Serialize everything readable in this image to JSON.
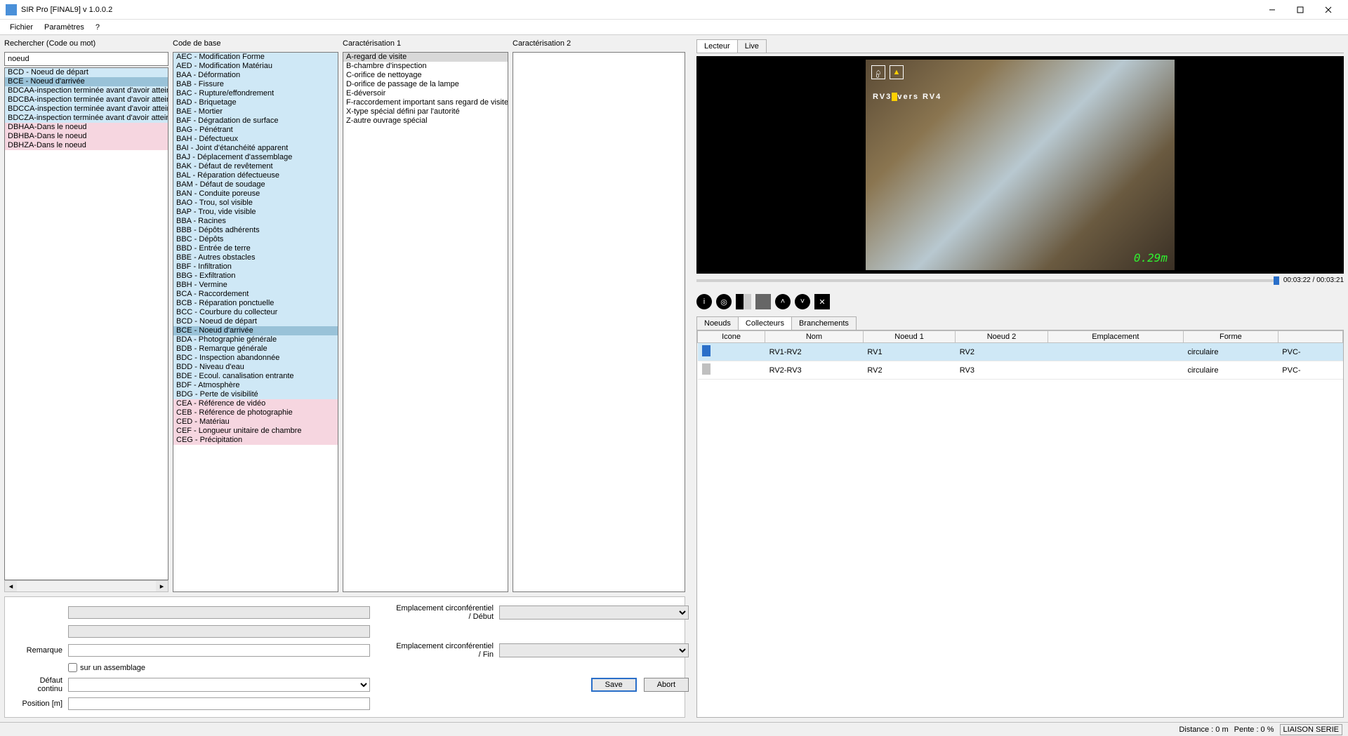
{
  "window": {
    "title": "SIR Pro [FINAL9]   v 1.0.0.2"
  },
  "menu": {
    "items": [
      "Fichier",
      "Paramètres",
      "?"
    ]
  },
  "search": {
    "label": "Rechercher (Code ou mot)",
    "value": "noeud",
    "results": [
      {
        "text": "BCD - Noeud de départ",
        "cls": "bg-blue"
      },
      {
        "text": "BCE - Noeud d'arrivée",
        "cls": "bg-darkblue"
      },
      {
        "text": "BDCAA-inspection terminée avant d'avoir atteint le noeu",
        "cls": "bg-blue"
      },
      {
        "text": "BDCBA-inspection terminée avant d'avoir atteint le noeu",
        "cls": "bg-blue"
      },
      {
        "text": "BDCCA-inspection terminée avant d'avoir atteint le noeu",
        "cls": "bg-blue"
      },
      {
        "text": "BDCZA-inspection terminée avant d'avoir atteint le noeu",
        "cls": "bg-blue"
      },
      {
        "text": "DBHAA-Dans le noeud",
        "cls": "bg-pink"
      },
      {
        "text": "DBHBA-Dans le noeud",
        "cls": "bg-pink"
      },
      {
        "text": "DBHZA-Dans le noeud",
        "cls": "bg-pink"
      }
    ]
  },
  "codes": {
    "label": "Code de base",
    "items": [
      {
        "text": "AEC - Modification Forme",
        "cls": "bg-blue"
      },
      {
        "text": "AED - Modification Matériau",
        "cls": "bg-blue"
      },
      {
        "text": "BAA - Déformation",
        "cls": "bg-blue"
      },
      {
        "text": "BAB - Fissure",
        "cls": "bg-blue"
      },
      {
        "text": "BAC - Rupture/effondrement",
        "cls": "bg-blue"
      },
      {
        "text": "BAD - Briquetage",
        "cls": "bg-blue"
      },
      {
        "text": "BAE - Mortier",
        "cls": "bg-blue"
      },
      {
        "text": "BAF - Dégradation de surface",
        "cls": "bg-blue"
      },
      {
        "text": "BAG - Pénétrant",
        "cls": "bg-blue"
      },
      {
        "text": "BAH - Défectueux",
        "cls": "bg-blue"
      },
      {
        "text": "BAI - Joint d'étanchéité apparent",
        "cls": "bg-blue"
      },
      {
        "text": "BAJ - Déplacement d'assemblage",
        "cls": "bg-blue"
      },
      {
        "text": "BAK - Défaut de revêtement",
        "cls": "bg-blue"
      },
      {
        "text": "BAL - Réparation défectueuse",
        "cls": "bg-blue"
      },
      {
        "text": "BAM - Défaut de soudage",
        "cls": "bg-blue"
      },
      {
        "text": "BAN - Conduite poreuse",
        "cls": "bg-blue"
      },
      {
        "text": "BAO - Trou, sol visible",
        "cls": "bg-blue"
      },
      {
        "text": "BAP - Trou, vide visible",
        "cls": "bg-blue"
      },
      {
        "text": "BBA - Racines",
        "cls": "bg-blue"
      },
      {
        "text": "BBB - Dépôts adhérents",
        "cls": "bg-blue"
      },
      {
        "text": "BBC - Dépôts",
        "cls": "bg-blue"
      },
      {
        "text": "BBD - Entrée de terre",
        "cls": "bg-blue"
      },
      {
        "text": "BBE - Autres obstacles",
        "cls": "bg-blue"
      },
      {
        "text": "BBF - Infiltration",
        "cls": "bg-blue"
      },
      {
        "text": "BBG - Exfiltration",
        "cls": "bg-blue"
      },
      {
        "text": "BBH - Vermine",
        "cls": "bg-blue"
      },
      {
        "text": "BCA - Raccordement",
        "cls": "bg-blue"
      },
      {
        "text": "BCB - Réparation ponctuelle",
        "cls": "bg-blue"
      },
      {
        "text": "BCC - Courbure du collecteur",
        "cls": "bg-blue"
      },
      {
        "text": "BCD - Noeud de départ",
        "cls": "bg-blue"
      },
      {
        "text": "BCE - Noeud d'arrivée",
        "cls": "bg-darkblue"
      },
      {
        "text": "BDA - Photographie générale",
        "cls": "bg-blue"
      },
      {
        "text": "BDB - Remarque générale",
        "cls": "bg-blue"
      },
      {
        "text": "BDC - Inspection abandonnée",
        "cls": "bg-blue"
      },
      {
        "text": "BDD - Niveau d'eau",
        "cls": "bg-blue"
      },
      {
        "text": "BDE - Ecoul. canalisation entrante",
        "cls": "bg-blue"
      },
      {
        "text": "BDF - Atmosphère",
        "cls": "bg-blue"
      },
      {
        "text": "BDG - Perte de visibilité",
        "cls": "bg-blue"
      },
      {
        "text": "CEA - Référence de vidéo",
        "cls": "bg-pink"
      },
      {
        "text": "CEB - Référence de photographie",
        "cls": "bg-pink"
      },
      {
        "text": "CED - Matériau",
        "cls": "bg-pink"
      },
      {
        "text": "CEF - Longueur unitaire de chambre",
        "cls": "bg-pink"
      },
      {
        "text": "CEG - Précipitation",
        "cls": "bg-pink"
      }
    ]
  },
  "carac1": {
    "label": "Caractérisation 1",
    "items": [
      "A-regard de visite",
      "B-chambre d'inspection",
      "C-orifice de nettoyage",
      "D-orifice de passage de la lampe",
      "E-déversoir",
      "F-raccordement important sans regard de visite",
      "X-type spécial défini par l'autorité",
      "Z-autre ouvrage spécial"
    ]
  },
  "carac2": {
    "label": "Caractérisation 2"
  },
  "form": {
    "remarque_label": "Remarque",
    "assemblage_label": "sur un assemblage",
    "defaut_label": "Défaut continu",
    "position_label": "Position [m]",
    "circ_debut_label": "Emplacement circonférentiel / Début",
    "circ_fin_label": "Emplacement circonférentiel / Fin",
    "save": "Save",
    "abort": "Abort"
  },
  "reader_tabs": {
    "lecteur": "Lecteur",
    "live": "Live"
  },
  "video": {
    "overlay_text_a": "RV3",
    "overlay_text_b": "vers RV4",
    "distance_overlay": "0.29m",
    "time": "00:03:22 / 00:03:21",
    "house_badge": "0"
  },
  "lower_tabs": {
    "noeuds": "Noeuds",
    "collecteurs": "Collecteurs",
    "branchements": "Branchements"
  },
  "table": {
    "headers": [
      "Icone",
      "Nom",
      "Noeud 1",
      "Noeud 2",
      "Emplacement",
      "Forme",
      ""
    ],
    "rows": [
      {
        "color": "#2a6fc9",
        "nom": "RV1-RV2",
        "n1": "RV1",
        "n2": "RV2",
        "emp": "",
        "forme": "circulaire",
        "mat": "PVC-"
      },
      {
        "color": "#c0c0c0",
        "nom": "RV2-RV3",
        "n1": "RV2",
        "n2": "RV3",
        "emp": "",
        "forme": "circulaire",
        "mat": "PVC-"
      }
    ]
  },
  "status": {
    "dist": "Distance : 0 m",
    "pente": "Pente : 0 %",
    "liaison": "LIAISON SERIE"
  }
}
